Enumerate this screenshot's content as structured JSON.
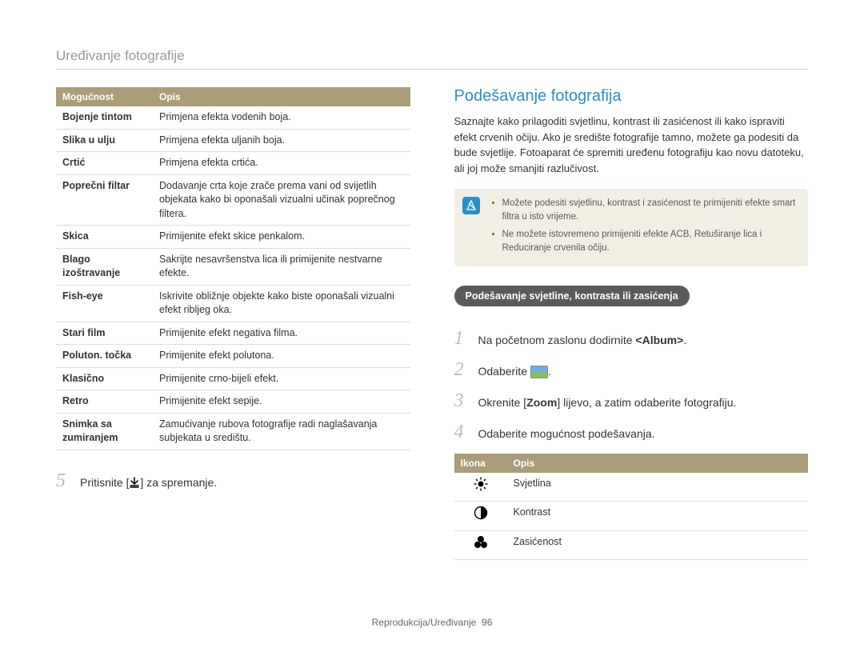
{
  "page_title": "Uređivanje fotografije",
  "left": {
    "table_header": {
      "col1": "Mogućnost",
      "col2": "Opis"
    },
    "rows": [
      {
        "name": "Bojenje tintom",
        "desc": "Primjena efekta vodenih boja."
      },
      {
        "name": "Slika u ulju",
        "desc": "Primjena efekta uljanih boja."
      },
      {
        "name": "Crtić",
        "desc": "Primjena efekta crtića."
      },
      {
        "name": "Poprečni filtar",
        "desc": "Dodavanje crta koje zrače prema vani od svijetlih objekata kako bi oponašali vizualni učinak poprečnog filtera."
      },
      {
        "name": "Skica",
        "desc": "Primijenite efekt skice penkalom."
      },
      {
        "name": "Blago izoštravanje",
        "desc": "Sakrijte nesavršenstva lica ili primijenite nestvarne efekte."
      },
      {
        "name": "Fish-eye",
        "desc": "Iskrivite obližnje objekte kako biste oponašali vizualni efekt ribljeg oka."
      },
      {
        "name": "Stari film",
        "desc": "Primijenite efekt negativa filma."
      },
      {
        "name": "Poluton. točka",
        "desc": "Primijenite efekt polutona."
      },
      {
        "name": "Klasično",
        "desc": "Primijenite crno-bijeli efekt."
      },
      {
        "name": "Retro",
        "desc": "Primijenite efekt sepije."
      },
      {
        "name": "Snimka sa zumiranjem",
        "desc": "Zamućivanje rubova fotografije radi naglašavanja subjekata u središtu."
      }
    ],
    "step5_num": "5",
    "step5_text_pre": "Pritisnite [",
    "step5_text_post": "] za spremanje."
  },
  "right": {
    "heading": "Podešavanje fotografija",
    "paragraph": "Saznajte kako prilagoditi svjetlinu, kontrast ili zasićenost ili kako ispraviti efekt crvenih očiju. Ako je središte fotografije tamno, možete ga podesiti da bude svjetlije. Fotoaparat će spremiti uređenu fotografiju kao novu datoteku, ali joj može smanjiti razlučivost.",
    "note_items": [
      "Možete podesiti svjetlinu, kontrast i zasićenost te primijeniti efekte smart filtra u isto vrijeme.",
      "Ne možete istovremeno primijeniti efekte ACB, Retuširanje lica i Reduciranje crvenila očiju."
    ],
    "pill": "Podešavanje svjetline, kontrasta ili zasićenja",
    "steps": {
      "s1_num": "1",
      "s1_pre": "Na početnom zaslonu dodirnite ",
      "s1_bold": "<Album>",
      "s1_post": ".",
      "s2_num": "2",
      "s2_pre": "Odaberite ",
      "s2_post": ".",
      "s3_num": "3",
      "s3_pre": "Okrenite [",
      "s3_bold": "Zoom",
      "s3_post": "] lijevo, a zatim odaberite fotografiju.",
      "s4_num": "4",
      "s4_text": "Odaberite mogućnost podešavanja."
    },
    "icon_table_header": {
      "col1": "Ikona",
      "col2": "Opis"
    },
    "icon_rows": {
      "r1_desc": "Svjetlina",
      "r2_desc": "Kontrast",
      "r3_desc": "Zasićenost"
    }
  },
  "footer": {
    "text": "Reprodukcija/Uređivanje",
    "page": "96"
  }
}
